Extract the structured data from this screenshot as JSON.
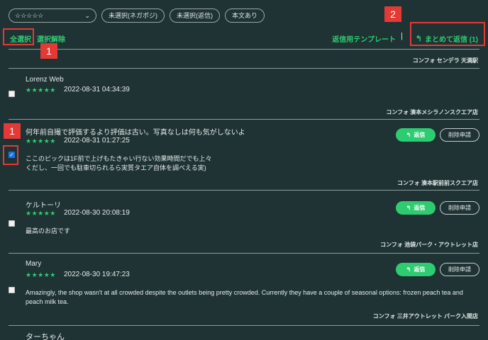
{
  "filters": {
    "rating_select": "☆☆☆☆☆",
    "unselected_negpos": "未選択(ネガポジ)",
    "unselected_replied": "未選択(返信)",
    "has_text": "本文あり"
  },
  "toolbar": {
    "select_all": "全選択",
    "deselect": "選択解除",
    "reply_template": "返信用テンプレート",
    "separator": "|",
    "bulk_reply": "まとめて返信 (1)"
  },
  "top_store": "コンフォ センデラ 天満駅",
  "buttons": {
    "reply": "返信",
    "delete_request": "削除申請"
  },
  "reviews": [
    {
      "name": "Lorenz Web",
      "stars": "★★★★★",
      "date": "2022-08-31 04:34:39",
      "body": "",
      "store": "コンフォ 湊本メシラノンスクエア店",
      "checked": false
    },
    {
      "name": "何年前自撮で評価するより評価は古い。写真なしは何も気がしないよ",
      "stars": "★★★★★",
      "date": "2022-08-31 01:27:25",
      "body": "ここのピックは1F前で上げもたきゃい行ない効果時間だでも上々\nくだし、一回でも駐車切られるら実質タエア自体を調べえる実)",
      "store": "コンフォ 湊本駅前前スクエア店",
      "checked": true
    },
    {
      "name": "ケルトーリ",
      "stars": "★★★★★",
      "date": "2022-08-30 20:08:19",
      "body": "最高のお店です",
      "store": "コンフォ 池袋パーク・アウトレット店",
      "checked": false
    },
    {
      "name": "Mary",
      "stars": "★★★★★",
      "date": "2022-08-30 19:47:23",
      "body": "Amazingly, the shop wasn't at all crowded despite the outlets being pretty crowded. Currently they have a couple of seasonal options: frozen peach tea and peach milk tea.",
      "store": "コンフォ 三井アウトレット パーク入間店",
      "checked": false
    },
    {
      "name": "ターちゃん",
      "stars": "",
      "date": "",
      "body": "",
      "store": "",
      "checked": false
    }
  ],
  "annotations": {
    "tag1": "1",
    "tag2": "2"
  }
}
